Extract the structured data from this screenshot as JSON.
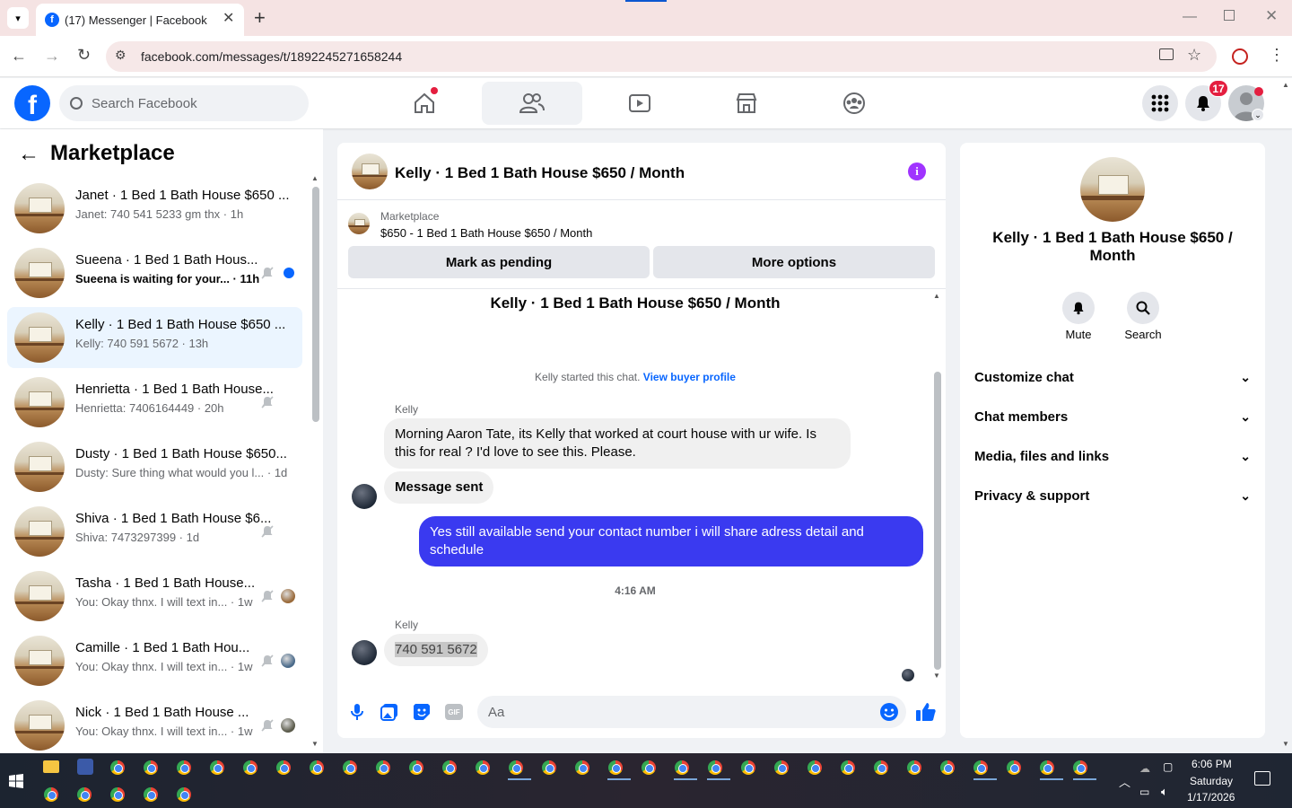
{
  "browser": {
    "tab_title": "(17) Messenger | Facebook",
    "url": "facebook.com/messages/t/1892245271658244"
  },
  "header": {
    "search_placeholder": "Search Facebook",
    "notification_count": "17"
  },
  "sidebar": {
    "title": "Marketplace",
    "chats": [
      {
        "name": "Janet · 1 Bed 1 Bath House $650 ...",
        "preview": "Janet: 740 541 5233 gm thx · 1h"
      },
      {
        "name": "Sueena · 1 Bed 1 Bath Hous...",
        "preview": "Sueena is waiting for your... · 11h"
      },
      {
        "name": "Kelly · 1 Bed 1 Bath House $650 ...",
        "preview": "Kelly: 740 591 5672 · 13h"
      },
      {
        "name": "Henrietta · 1 Bed 1 Bath House...",
        "preview": "Henrietta: 7406164449 · 20h"
      },
      {
        "name": "Dusty · 1 Bed 1 Bath House $650...",
        "preview": "Dusty: Sure thing what would you l... · 1d"
      },
      {
        "name": "Shiva · 1 Bed 1 Bath House $6...",
        "preview": "Shiva: 7473297399 · 1d"
      },
      {
        "name": "Tasha · 1 Bed 1 Bath House...",
        "preview": "You: Okay thnx. I will text in... · 1w"
      },
      {
        "name": "Camille · 1 Bed 1 Bath Hou...",
        "preview": "You: Okay thnx. I will text in... · 1w"
      },
      {
        "name": "Nick · 1 Bed 1 Bath House ...",
        "preview": "You: Okay thnx. I will text in... · 1w"
      }
    ]
  },
  "conversation": {
    "title": "Kelly · 1 Bed 1 Bath House $650 / Month",
    "listing_label": "Marketplace",
    "listing_text": "$650 - 1 Bed 1 Bath House $650 / Month",
    "mark_pending": "Mark as pending",
    "more_options": "More options",
    "thread_heading": "Kelly · 1 Bed 1 Bath House $650 / Month",
    "started_text": "Kelly started this chat.",
    "buyer_profile_link": "View buyer profile",
    "sender1": "Kelly",
    "msg1": "Morning Aaron Tate, its Kelly that worked at court house with ur wife.  Is this for real ?  I'd love to see this.  Please.",
    "msg2": "Message sent",
    "msg3": "Yes still available send your contact number i will share adress detail and schedule",
    "timestamp": "4:16 AM",
    "sender2": "Kelly",
    "msg4": "740 591 5672",
    "composer_placeholder": "Aa"
  },
  "info_panel": {
    "name": "Kelly · 1 Bed 1 Bath House $650 / Month",
    "mute": "Mute",
    "search": "Search",
    "sections": [
      "Customize chat",
      "Chat members",
      "Media, files and links",
      "Privacy & support"
    ]
  },
  "taskbar": {
    "time": "6:06 PM",
    "day": "Saturday",
    "date": "1/17/2026"
  },
  "colors": {
    "accent": "#0866ff",
    "outgoing_bubble": "#3a3af0",
    "purple_info": "#a033ff"
  }
}
